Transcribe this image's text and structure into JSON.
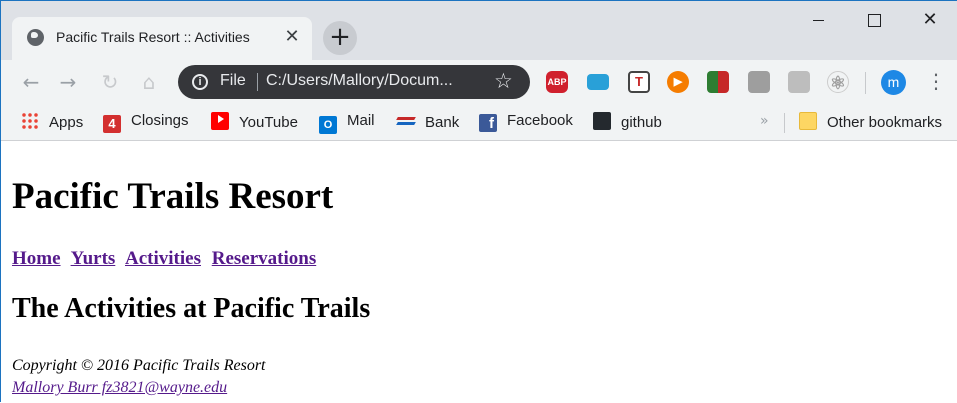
{
  "browser": {
    "tab": {
      "title": "Pacific Trails Resort :: Activities"
    },
    "omnibox": {
      "scheme": "File",
      "url": "C:/Users/Mallory/Docum..."
    },
    "avatar_letter": "m",
    "extensions": [
      "ABP",
      "T"
    ],
    "bookmarks": [
      {
        "label": "Apps",
        "icon": "apps-icon"
      },
      {
        "label": "Closings",
        "icon": "closings-icon"
      },
      {
        "label": "YouTube",
        "icon": "youtube-icon"
      },
      {
        "label": "Mail",
        "icon": "outlook-mail-icon"
      },
      {
        "label": "Bank",
        "icon": "bank-icon"
      },
      {
        "label": "Facebook",
        "icon": "facebook-icon"
      },
      {
        "label": "github",
        "icon": "github-icon"
      }
    ],
    "other_bookmarks": "Other bookmarks"
  },
  "page": {
    "title": "Pacific Trails Resort",
    "nav": [
      "Home",
      "Yurts",
      "Activities",
      "Reservations"
    ],
    "heading": "The Activities at Pacific Trails",
    "copyright": "Copyright © 2016 Pacific Trails Resort",
    "contact": "Mallory Burr fz3821@wayne.edu"
  }
}
